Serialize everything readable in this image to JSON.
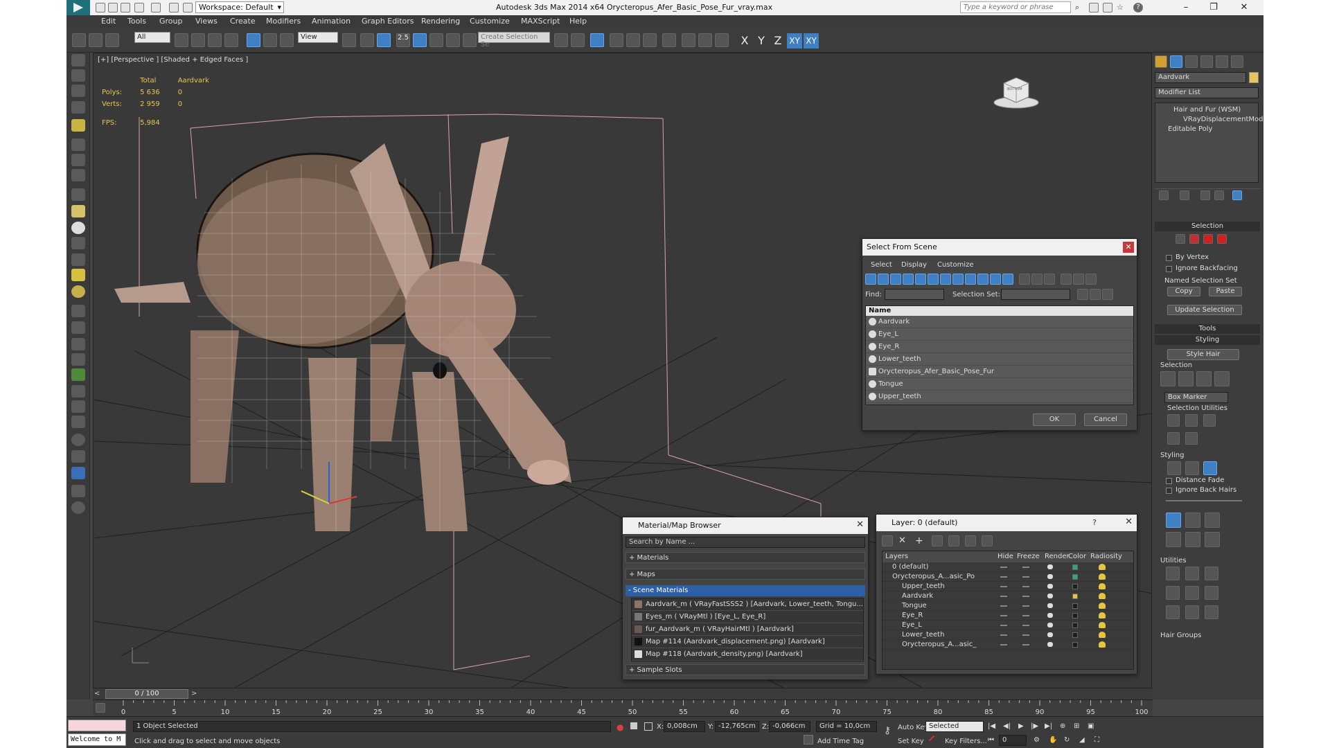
{
  "titlebar": {
    "workspace": "Workspace: Default",
    "title": "Autodesk 3ds Max  2014 x64     Orycteropus_Afer_Basic_Pose_Fur_vray.max",
    "search_placeholder": "Type a keyword or phrase"
  },
  "menus": [
    "Edit",
    "Tools",
    "Group",
    "Views",
    "Create",
    "Modifiers",
    "Animation",
    "Graph Editors",
    "Rendering",
    "Customize",
    "MAXScript",
    "Help"
  ],
  "toolbar": {
    "filter": "All",
    "refcoord": "View",
    "snap_label": "2.5",
    "selection_set_placeholder": "Create Selection Se",
    "axes": [
      "X",
      "Y",
      "Z",
      "XY",
      "XY"
    ]
  },
  "viewport": {
    "label": "[+] [Perspective ] [Shaded + Edged Faces ]",
    "stats": {
      "col_total": "Total",
      "col_obj": "Aardvark",
      "polys_label": "Polys:",
      "polys_total": "5 636",
      "polys_obj": "0",
      "verts_label": "Verts:",
      "verts_total": "2 959",
      "verts_obj": "0",
      "fps_label": "FPS:",
      "fps_value": "5,984"
    },
    "navcube_label": "BOTTOM"
  },
  "select_from_scene": {
    "title": "Select From Scene",
    "tabs": [
      "Select",
      "Display",
      "Customize"
    ],
    "find_label": "Find:",
    "selection_set_label": "Selection Set:",
    "column_name": "Name",
    "objects": [
      "Aardvark",
      "Eye_L",
      "Eye_R",
      "Lower_teeth",
      "Orycteropus_Afer_Basic_Pose_Fur",
      "Tongue",
      "Upper_teeth"
    ],
    "ok": "OK",
    "cancel": "Cancel"
  },
  "material_browser": {
    "title": "Material/Map Browser",
    "search_placeholder": "Search by Name ...",
    "sections": [
      "+ Materials",
      "+ Maps",
      "- Scene Materials",
      "+ Sample Slots"
    ],
    "scene_materials": [
      "Aardvark_m  ( VRayFastSSS2 ) [Aardvark, Lower_teeth, Tongu...",
      "Eyes_m  ( VRayMtl ) [Eye_L, Eye_R]",
      "fur_Aardvark_m  ( VRayHairMtl ) [Aardvark]",
      "Map #114 (Aardvark_displacement.png) [Aardvark]",
      "Map #118 (Aardvark_density.png) [Aardvark]"
    ]
  },
  "layer_manager": {
    "title": "Layer: 0 (default)",
    "help": "?",
    "columns": [
      "Layers",
      "Hide",
      "Freeze",
      "Render",
      "Color",
      "Radiosity"
    ],
    "layers": [
      {
        "name": "0 (default)",
        "color": "#2fa77a"
      },
      {
        "name": "Orycteropus_A...asic_Po",
        "color": "#2fa77a"
      },
      {
        "name": "Upper_teeth",
        "color": "#1e1e1e"
      },
      {
        "name": "Aardvark",
        "color": "#e0c640"
      },
      {
        "name": "Tongue",
        "color": "#1e1e1e"
      },
      {
        "name": "Eye_R",
        "color": "#1e1e1e"
      },
      {
        "name": "Eye_L",
        "color": "#1e1e1e"
      },
      {
        "name": "Lower_teeth",
        "color": "#1e1e1e"
      },
      {
        "name": "Orycteropus_A...asic_",
        "color": "#1e1e1e"
      }
    ]
  },
  "command_panel": {
    "object_name": "Aardvark",
    "modifier_list": "Modifier List",
    "stack": [
      "Hair and Fur (WSM)",
      "VRayDisplacementMod",
      "Editable Poly"
    ],
    "selection_header": "Selection",
    "by_vertex": "By Vertex",
    "ignore_backfacing": "Ignore Backfacing",
    "named_selection_set": "Named Selection Set",
    "copy": "Copy",
    "paste": "Paste",
    "update_selection": "Update Selection",
    "tools_header": "Tools",
    "styling_header": "Styling",
    "style_hair": "Style Hair",
    "selection_sub": "Selection",
    "box_marker": "Box Marker",
    "selection_utilities": "Selection Utilities",
    "styling_sub": "Styling",
    "distance_fade": "Distance Fade",
    "ignore_back_hairs": "Ignore Back Hairs",
    "utilities": "Utilities",
    "hair_groups": "Hair Groups"
  },
  "timeline": {
    "frame": "0 / 100",
    "ticks": [
      "0",
      "5",
      "10",
      "15",
      "20",
      "25",
      "30",
      "35",
      "40",
      "45",
      "50",
      "55",
      "60",
      "65",
      "70",
      "75",
      "80",
      "85",
      "90",
      "95",
      "100"
    ]
  },
  "statusbar": {
    "maxscript_text": "Welcome to M",
    "selection_info": "1 Object Selected",
    "prompt": "Click and drag to select and move objects",
    "x_label": "X:",
    "x_value": "0,008cm",
    "y_label": "Y:",
    "y_value": "-12,765cm",
    "z_label": "Z:",
    "z_value": "-0,066cm",
    "grid": "Grid = 10,0cm",
    "add_time_tag": "Add Time Tag",
    "auto_key": "Auto Key",
    "set_key": "Set Key",
    "selected": "Selected",
    "key_filters": "Key Filters...",
    "frame_field": "0"
  }
}
